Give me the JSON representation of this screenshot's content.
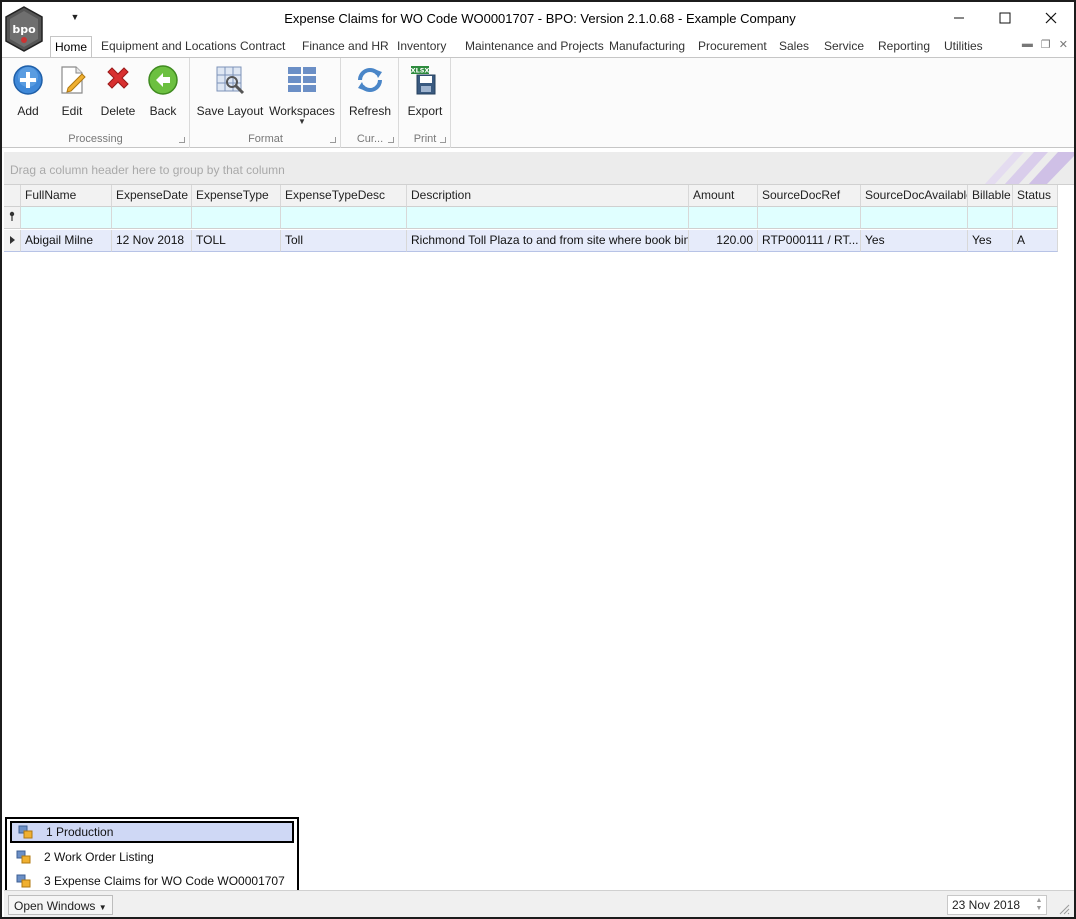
{
  "window": {
    "title": "Expense Claims for WO Code WO0001707 - BPO: Version 2.1.0.68 - Example Company",
    "logo_icon": "bpo-logo-icon"
  },
  "ribbon_tabs": [
    "Home",
    "Equipment and Locations",
    "Contract",
    "Finance and HR",
    "Inventory",
    "Maintenance and Projects",
    "Manufacturing",
    "Procurement",
    "Sales",
    "Service",
    "Reporting",
    "Utilities"
  ],
  "active_tab": "Home",
  "ribbon": {
    "processing": {
      "label": "Processing",
      "add": "Add",
      "edit": "Edit",
      "delete": "Delete",
      "back": "Back"
    },
    "format": {
      "label": "Format",
      "save_layout": "Save Layout",
      "workspaces": "Workspaces"
    },
    "current": {
      "label": "Cur...",
      "refresh": "Refresh"
    },
    "print": {
      "label": "Print",
      "export": "Export"
    }
  },
  "group_panel": {
    "placeholder": "Drag a column header here to group by that column"
  },
  "grid": {
    "columns": [
      "FullName",
      "ExpenseDate",
      "ExpenseType",
      "ExpenseTypeDesc",
      "Description",
      "Amount",
      "SourceDocRef",
      "SourceDocAvailable",
      "Billable",
      "Status"
    ],
    "rows": [
      [
        "Abigail Milne",
        "12 Nov 2018",
        "TOLL",
        "Toll",
        "Richmond Toll Plaza to and from site where book bindi...",
        "120.00",
        "RTP000111 / RT...",
        "Yes",
        "Yes",
        "A"
      ]
    ]
  },
  "open_windows_popup": {
    "items": [
      "1 Production",
      "2 Work Order Listing",
      "3 Expense Claims for WO Code WO0001707"
    ],
    "selected_index": 0
  },
  "statusbar": {
    "open_windows_label": "Open Windows",
    "date": "23 Nov 2018"
  },
  "colors": {
    "selected_row": "#e6ebfa",
    "filter_row": "#e0ffff",
    "popup_selected": "#cfd8f5"
  }
}
